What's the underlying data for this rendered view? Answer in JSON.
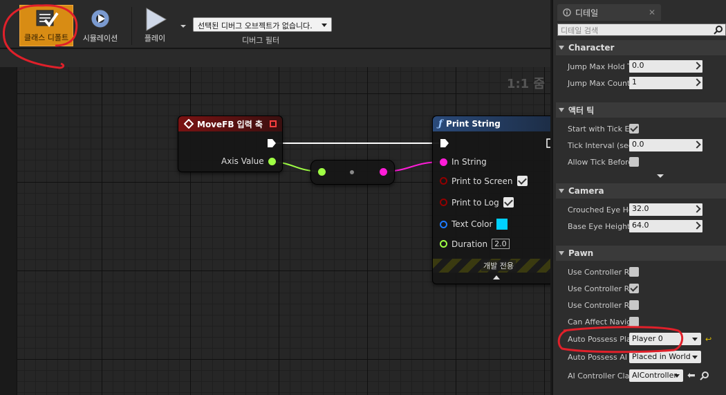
{
  "toolbar": {
    "class_defaults_label": "클래스 디폴트",
    "simulation_label": "시뮬레이션",
    "play_label": "플레이",
    "debug_object_value": "선택된 디버그 오브젝트가 없습니다.",
    "debug_filter_label": "디버그 필터"
  },
  "graph": {
    "zoom": "1:1 줌",
    "input_node": {
      "title": "MoveFB 입력 축",
      "axis_value_label": "Axis Value"
    },
    "print_node": {
      "title": "Print String",
      "in_string": "In String",
      "print_to_screen": "Print to Screen",
      "print_to_log": "Print to Log",
      "text_color": "Text Color",
      "duration": "Duration",
      "duration_value": "2.0",
      "dev_only": "개발 전용"
    },
    "colors": {
      "exec": "#ffffff",
      "float": "#9fff44",
      "string": "#ff1cd8",
      "bool": "#920000",
      "color": "#1e7bff",
      "text_color_swatch": "#00d0ff"
    }
  },
  "details": {
    "tab_title": "디테일",
    "search_placeholder": "디테일 검색",
    "sections": {
      "character": {
        "title": "Character",
        "jump_max_hold_label": "Jump Max Hold T",
        "jump_max_hold_value": "0.0",
        "jump_max_count_label": "Jump Max Count",
        "jump_max_count_value": "1"
      },
      "actor_tick": {
        "title": "액터 틱",
        "start_with_tick_label": "Start with Tick En",
        "tick_interval_label": "Tick Interval (sec",
        "tick_interval_value": "0.0",
        "allow_tick_before_label": "Allow Tick Before"
      },
      "camera": {
        "title": "Camera",
        "crouched_eye_label": "Crouched Eye Hei",
        "crouched_eye_value": "32.0",
        "base_eye_label": "Base Eye Height",
        "base_eye_value": "64.0"
      },
      "pawn": {
        "title": "Pawn",
        "use_ctrl_rot_1": "Use Controller Rot",
        "use_ctrl_rot_2": "Use Controller Rot",
        "use_ctrl_rot_3": "Use Controller Rot",
        "can_affect_nav": "Can Affect Naviga",
        "auto_possess_player_label": "Auto Possess Pla",
        "auto_possess_player_value": "Player 0",
        "auto_possess_ai_label": "Auto Possess AI",
        "auto_possess_ai_value": "Placed in World",
        "ai_controller_label": "AI Controller Clas",
        "ai_controller_value": "AIController"
      }
    }
  },
  "annotation_color": "#e0202a"
}
